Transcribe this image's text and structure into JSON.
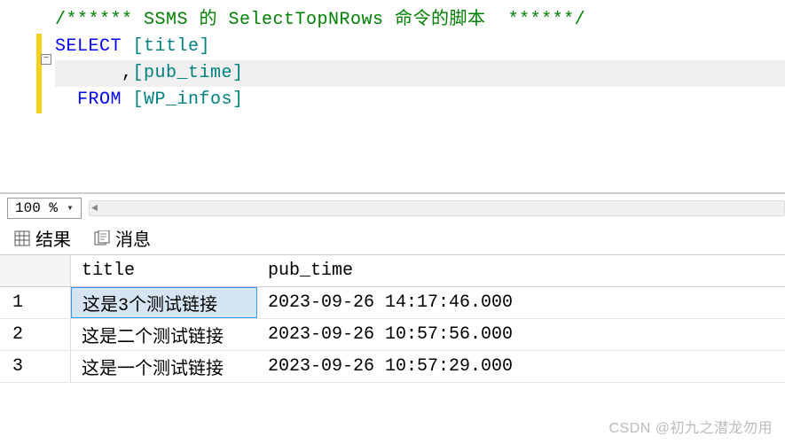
{
  "editor": {
    "lines": {
      "comment_prefix": "/****** ",
      "comment_text": "SSMS 的 SelectTopNRows 命令的脚本",
      "comment_suffix": "  ******/",
      "select_kw": "SELECT",
      "title_col": " [title]",
      "comma_indent": "      ,",
      "pubtime_col": "[pub_time]",
      "from_kw": "  FROM",
      "table_name": " [WP_infos]"
    },
    "zoom": "100 %"
  },
  "tabs": {
    "results": "结果",
    "messages": "消息"
  },
  "grid": {
    "columns": {
      "title": "title",
      "pub_time": "pub_time"
    },
    "rows": [
      {
        "n": "1",
        "title": "这是3个测试链接",
        "pub_time": "2023-09-26 14:17:46.000"
      },
      {
        "n": "2",
        "title": "这是二个测试链接",
        "pub_time": "2023-09-26 10:57:56.000"
      },
      {
        "n": "3",
        "title": "这是一个测试链接",
        "pub_time": "2023-09-26 10:57:29.000"
      }
    ]
  },
  "watermark": "CSDN @初九之潜龙勿用"
}
